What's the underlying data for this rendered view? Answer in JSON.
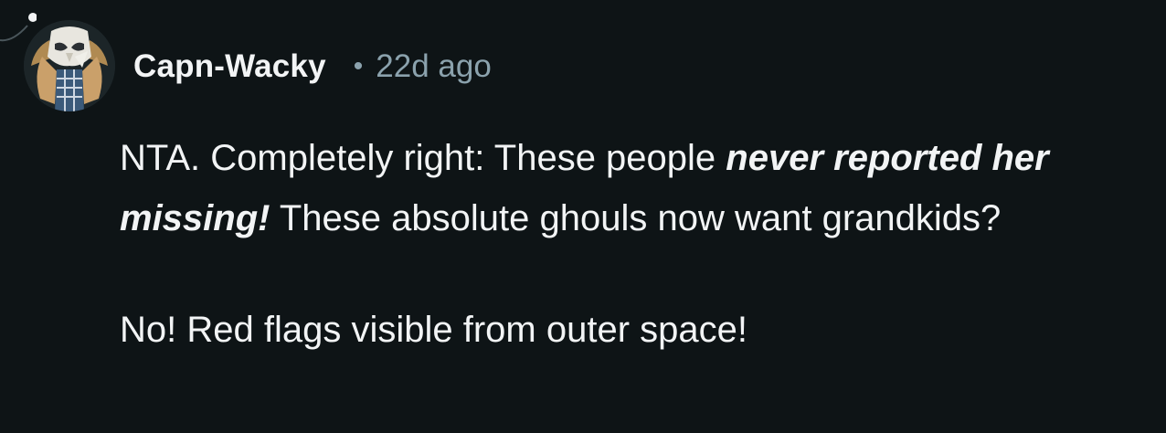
{
  "comment": {
    "username": "Capn-Wacky",
    "separator": "•",
    "timestamp": "22d ago",
    "avatar_icon": "user-avatar-icon",
    "paragraphs": [
      {
        "text_before": "NTA. Completely right: These people ",
        "emphasis": "never reported her missing!",
        "text_after": " These absolute ghouls now want grandkids?"
      },
      {
        "text": "No! Red flags visible from outer space!"
      }
    ]
  },
  "colors": {
    "background": "#0e1416",
    "text": "#f2f4f5",
    "meta": "#8ba2ad"
  }
}
